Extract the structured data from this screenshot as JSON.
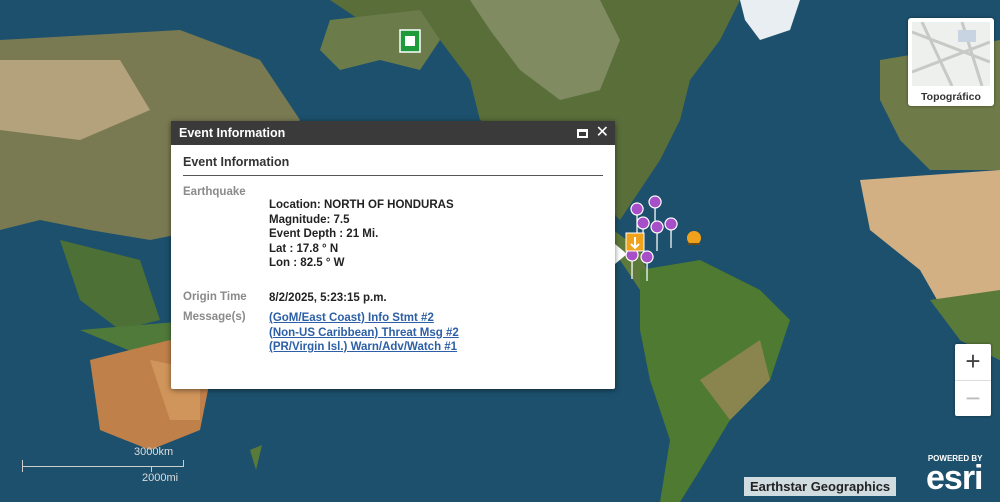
{
  "popup": {
    "header_title": "Event Information",
    "title": "Event Information",
    "section_label": "Earthquake",
    "location": "Location: NORTH OF HONDURAS",
    "magnitude": "Magnitude: 7.5",
    "depth": "Event Depth : 21 Mi.",
    "lat": "Lat : 17.8 ° N",
    "lon": "Lon : 82.5 ° W",
    "origin_label": "Origin Time",
    "origin_value": "8/2/2025, 5:23:15 p.m.",
    "messages_label": "Message(s)",
    "messages": [
      "(GoM/East Coast) Info Stmt #2",
      "(Non-US Caribbean) Threat Msg #2",
      "(PR/Virgin Isl.) Warn/Adv/Watch #1"
    ]
  },
  "basemap": {
    "label": "Topográfico"
  },
  "zoom": {
    "in": "+",
    "out": "−"
  },
  "scale": {
    "km": "3000km",
    "mi": "2000mi"
  },
  "attribution": "Earthstar Geographics",
  "esri": {
    "powered": "POWERED BY",
    "name": "esri"
  },
  "colors": {
    "ocean": "#1b4a66",
    "marker": "#a64fc9",
    "warning": "#f0a21c"
  }
}
